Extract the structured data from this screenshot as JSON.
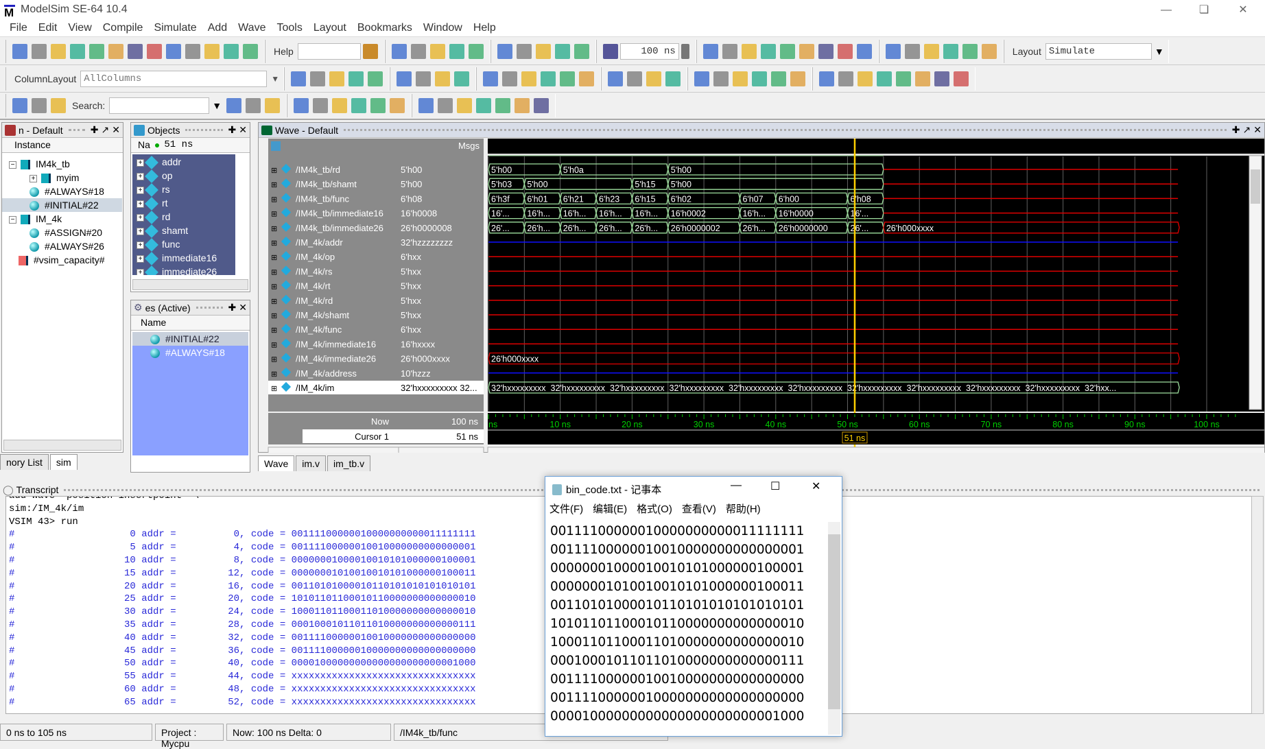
{
  "app": {
    "title": "ModelSim SE-64 10.4",
    "window_controls": [
      "minimize",
      "restore",
      "close"
    ]
  },
  "menu": [
    "File",
    "Edit",
    "View",
    "Compile",
    "Simulate",
    "Add",
    "Wave",
    "Tools",
    "Layout",
    "Bookmarks",
    "Window",
    "Help"
  ],
  "toolbar": {
    "help_label": "Help",
    "help_value": "",
    "run_length": "100 ns",
    "layout_label": "Layout",
    "layout_value": "Simulate",
    "column_layout_label": "ColumnLayout",
    "column_layout_value": "AllColumns",
    "search_label": "Search:",
    "search_value": ""
  },
  "sim_pane": {
    "title": "n - Default",
    "column": "Instance",
    "items": [
      {
        "label": "IM4k_tb",
        "type": "module",
        "expanded": true
      },
      {
        "label": "myim",
        "type": "module"
      },
      {
        "label": "#ALWAYS#18",
        "type": "process"
      },
      {
        "label": "#INITIAL#22",
        "type": "process",
        "selected": true
      },
      {
        "label": "IM_4k",
        "type": "module",
        "expanded": true
      },
      {
        "label": "#ASSIGN#20",
        "type": "process"
      },
      {
        "label": "#ALWAYS#26",
        "type": "process"
      },
      {
        "label": "#vsim_capacity#",
        "type": "capacity"
      }
    ],
    "tabs": [
      "nory List",
      "sim"
    ]
  },
  "objects_pane": {
    "title": "Objects",
    "column": "Na",
    "time": "51 ns",
    "items": [
      "addr",
      "op",
      "rs",
      "rt",
      "rd",
      "shamt",
      "func",
      "immediate16",
      "immediate26"
    ]
  },
  "processes_pane": {
    "title": "es (Active)",
    "column": "Name",
    "items": [
      "#INITIAL#22",
      "#ALWAYS#18"
    ]
  },
  "wave": {
    "title": "Wave - Default",
    "msgs_label": "Msgs",
    "now_label": "Now",
    "now_value": "100 ns",
    "cursor_label": "Cursor 1",
    "cursor_value": "51 ns",
    "cursor_time": 51,
    "time_range": [
      0,
      105
    ],
    "ticks": [
      "ns",
      "10 ns",
      "20 ns",
      "30 ns",
      "40 ns",
      "50 ns",
      "60 ns",
      "70 ns",
      "80 ns",
      "90 ns",
      "100 ns"
    ],
    "colors": {
      "bus": "#9fe09f",
      "x": "#e00000",
      "z": "#1010ff",
      "cursor": "#ffd000",
      "grid": "#606060",
      "time_text": "#00d000"
    },
    "data_end": 55,
    "signals": [
      {
        "name": "/IM4k_tb/rd",
        "value": "5'h00",
        "kind": "bus",
        "segs": [
          [
            0,
            "5'h00"
          ],
          [
            10,
            "5'h0a"
          ],
          [
            25,
            "5'h00"
          ]
        ],
        "after": "x"
      },
      {
        "name": "/IM4k_tb/shamt",
        "value": "5'h00",
        "kind": "bus",
        "segs": [
          [
            0,
            "5'h03"
          ],
          [
            5,
            "5'h00"
          ],
          [
            20,
            "5'h15"
          ],
          [
            25,
            "5'h00"
          ]
        ],
        "after": "x"
      },
      {
        "name": "/IM4k_tb/func",
        "value": "6'h08",
        "kind": "bus",
        "segs": [
          [
            0,
            "6'h3f"
          ],
          [
            5,
            "6'h01"
          ],
          [
            10,
            "6'h21"
          ],
          [
            15,
            "6'h23"
          ],
          [
            20,
            "6'h15"
          ],
          [
            25,
            "6'h02"
          ],
          [
            35,
            "6'h07"
          ],
          [
            40,
            "6'h00"
          ],
          [
            50,
            "6'h08"
          ]
        ],
        "after": "x"
      },
      {
        "name": "/IM4k_tb/immediate16",
        "value": "16'h0008",
        "kind": "bus",
        "segs": [
          [
            0,
            "16'..."
          ],
          [
            5,
            "16'h..."
          ],
          [
            10,
            "16'h..."
          ],
          [
            15,
            "16'h..."
          ],
          [
            20,
            "16'h..."
          ],
          [
            25,
            "16'h0002"
          ],
          [
            35,
            "16'h..."
          ],
          [
            40,
            "16'h0000"
          ],
          [
            50,
            "16'..."
          ]
        ],
        "after": "x"
      },
      {
        "name": "/IM4k_tb/immediate26",
        "value": "26'h0000008",
        "kind": "bus",
        "segs": [
          [
            0,
            "26'..."
          ],
          [
            5,
            "26'h..."
          ],
          [
            10,
            "26'h..."
          ],
          [
            15,
            "26'h..."
          ],
          [
            20,
            "26'h..."
          ],
          [
            25,
            "26'h0000002"
          ],
          [
            35,
            "26'h..."
          ],
          [
            40,
            "26'h0000000"
          ],
          [
            50,
            "26'..."
          ]
        ],
        "after": "xbus",
        "after_label": "26'h000xxxx"
      },
      {
        "name": "/IM_4k/addr",
        "value": "32'hzzzzzzzz",
        "kind": "z"
      },
      {
        "name": "/IM_4k/op",
        "value": "6'hxx",
        "kind": "x"
      },
      {
        "name": "/IM_4k/rs",
        "value": "5'hxx",
        "kind": "x"
      },
      {
        "name": "/IM_4k/rt",
        "value": "5'hxx",
        "kind": "x"
      },
      {
        "name": "/IM_4k/rd",
        "value": "5'hxx",
        "kind": "x"
      },
      {
        "name": "/IM_4k/shamt",
        "value": "5'hxx",
        "kind": "x"
      },
      {
        "name": "/IM_4k/func",
        "value": "6'hxx",
        "kind": "x"
      },
      {
        "name": "/IM_4k/immediate16",
        "value": "16'hxxxx",
        "kind": "x"
      },
      {
        "name": "/IM_4k/immediate26",
        "value": "26'h000xxxx",
        "kind": "xbus",
        "label": "26'h000xxxx"
      },
      {
        "name": "/IM_4k/address",
        "value": "10'hzzz",
        "kind": "z"
      },
      {
        "name": "/IM_4k/im",
        "value": "32'hxxxxxxxxx 32...",
        "kind": "membus",
        "label": "32'hxxxxxxxxx",
        "last_label": "32'hxx...",
        "selected": true
      }
    ]
  },
  "editor_tabs": [
    "Wave",
    "im.v",
    "im_tb.v"
  ],
  "transcript": {
    "title": "Transcript",
    "lines": [
      {
        "t": "add wave -position insertpoint  \\",
        "out": false
      },
      {
        "t": "sim:/IM_4k/im",
        "out": false
      },
      {
        "t": "VSIM 43> run",
        "out": false
      },
      {
        "t": "#                    0 addr =          0, code = 00111100000010000000000011111111",
        "out": true
      },
      {
        "t": "#                    5 addr =          4, code = 00111100000010010000000000000001",
        "out": true
      },
      {
        "t": "#                   10 addr =          8, code = 00000001000010010101000000100001",
        "out": true
      },
      {
        "t": "#                   15 addr =         12, code = 00000001010010010101000000100011",
        "out": true
      },
      {
        "t": "#                   20 addr =         16, code = 00110101000010110101010101010101",
        "out": true
      },
      {
        "t": "#                   25 addr =         20, code = 10101101100010110000000000000010",
        "out": true
      },
      {
        "t": "#                   30 addr =         24, code = 10001101100011010000000000000010",
        "out": true
      },
      {
        "t": "#                   35 addr =         28, code = 00010001011011010000000000000111",
        "out": true
      },
      {
        "t": "#                   40 addr =         32, code = 00111100000010010000000000000000",
        "out": true
      },
      {
        "t": "#                   45 addr =         36, code = 00111100000010000000000000000000",
        "out": true
      },
      {
        "t": "#                   50 addr =         40, code = 00001000000000000000000000001000",
        "out": true
      },
      {
        "t": "#                   55 addr =         44, code = xxxxxxxxxxxxxxxxxxxxxxxxxxxxxxxx",
        "out": true
      },
      {
        "t": "#                   60 addr =         48, code = xxxxxxxxxxxxxxxxxxxxxxxxxxxxxxxx",
        "out": true
      },
      {
        "t": "#                   65 addr =         52, code = xxxxxxxxxxxxxxxxxxxxxxxxxxxxxxxx",
        "out": true
      }
    ]
  },
  "status": {
    "range": "0 ns to 105 ns",
    "project": "Project : Mycpu",
    "now": "Now: 100 ns  Delta: 0",
    "path": "/IM4k_tb/func"
  },
  "notepad": {
    "title": "bin_code.txt - 记事本",
    "menu": [
      "文件(F)",
      "编辑(E)",
      "格式(O)",
      "查看(V)",
      "帮助(H)"
    ],
    "lines": [
      "00111100000010000000000011111111",
      "00111100000010010000000000000001",
      "00000001000010010101000000100001",
      "00000001010010010101000000100011",
      "00110101000010110101010101010101",
      "10101101100010110000000000000010",
      "10001101100011010000000000000010",
      "00010001011011010000000000000111",
      "00111100000010010000000000000000",
      "00111100000010000000000000000000",
      "00001000000000000000000000001000"
    ]
  }
}
